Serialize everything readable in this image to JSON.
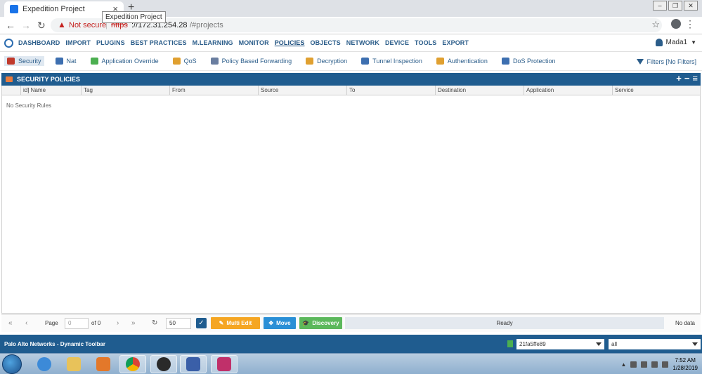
{
  "browser": {
    "tab_title": "Expedition Project",
    "tooltip": "Expedition Project",
    "new_tab": "+",
    "tab_close": "×",
    "not_secure": "Not secure",
    "url_scheme": "https",
    "url_host": "://172.31.254.28",
    "url_path": "/#projects"
  },
  "main_nav": {
    "items": [
      "DASHBOARD",
      "IMPORT",
      "PLUGINS",
      "BEST PRACTICES",
      "M.LEARNING",
      "MONITOR",
      "POLICIES",
      "OBJECTS",
      "NETWORK",
      "DEVICE",
      "TOOLS",
      "EXPORT"
    ],
    "active": "POLICIES",
    "user_name": "Mada1"
  },
  "sub_nav": {
    "items": [
      "Security",
      "Nat",
      "Application Override",
      "QoS",
      "Policy Based Forwarding",
      "Decryption",
      "Tunnel Inspection",
      "Authentication",
      "DoS Protection"
    ],
    "active": "Security",
    "filters_label": "Filters [No Filters]"
  },
  "panel": {
    "title": "SECURITY POLICIES",
    "columns": [
      "id] Name",
      "Tag",
      "From",
      "Source",
      "To",
      "Destination",
      "Application",
      "Service"
    ],
    "empty_message": "No Security Rules"
  },
  "pager": {
    "page_label": "Page",
    "page_value": "0",
    "of_label": "of 0",
    "page_size": "50",
    "multi_edit": "Multi Edit",
    "move": "Move",
    "discovery": "Discovery",
    "status": "Ready",
    "no_data": "No data"
  },
  "dynamic_toolbar": {
    "label": "Palo Alto Networks - Dynamic Toolbar",
    "project_id": "21fa5ffe89",
    "filter_value": "all"
  },
  "taskbar": {
    "time": "7:52 AM",
    "date": "1/28/2019"
  },
  "colors": {
    "brand_blue": "#1f5c8f",
    "multi_edit": "#f5a623",
    "move": "#2a8fd6",
    "discovery": "#5cb85c"
  }
}
